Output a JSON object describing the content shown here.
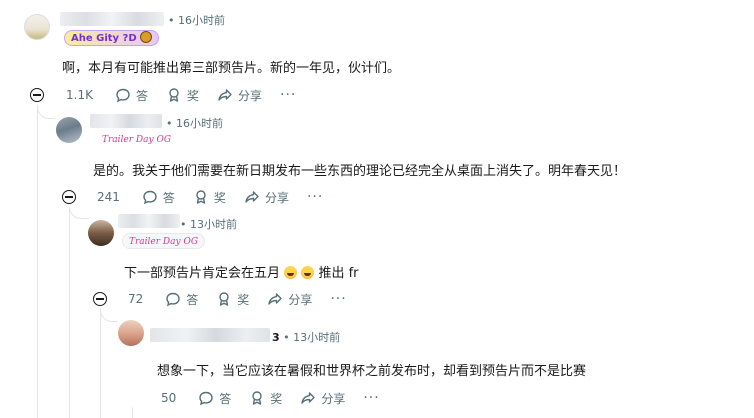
{
  "comments": [
    {
      "time": "16小时前",
      "flair": "Ahe Gity ?D",
      "text": "啊，本月有可能推出第三部预告片。新的一年见，伙计们。",
      "votes": "1.1K"
    },
    {
      "time": "16小时前",
      "flair": "Trailer Day OG",
      "text": "是的。我关于他们需要在新日期发布一些东西的理论已经完全从桌面上消失了。明年春天见！",
      "votes": "241"
    },
    {
      "time": "13小时前",
      "flair": "Trailer Day OG",
      "text_before": "下一部预告片肯定会在五月",
      "text_after": "推出 fr",
      "votes": "72"
    },
    {
      "name_suffix": "3",
      "time": "13小时前",
      "text": "想象一下，当它应该在暑假和世界杯之前发布时，却看到预告片而不是比赛",
      "votes": "50"
    }
  ],
  "actions": {
    "reply": "答",
    "award": "奖",
    "share": "分享",
    "more": "···"
  },
  "meta_separator": "•"
}
